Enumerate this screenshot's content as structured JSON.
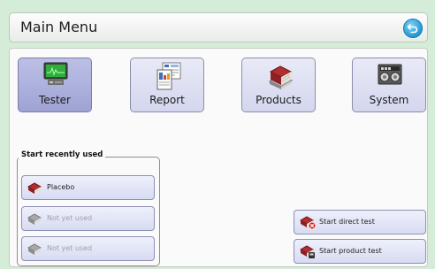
{
  "header": {
    "title": "Main Menu"
  },
  "tiles": [
    {
      "label": "Tester",
      "icon": "tester-monitor-icon",
      "selected": true
    },
    {
      "label": "Report",
      "icon": "report-document-icon",
      "selected": false
    },
    {
      "label": "Products",
      "icon": "products-books-icon",
      "selected": false
    },
    {
      "label": "System",
      "icon": "system-panel-icon",
      "selected": false
    }
  ],
  "recent": {
    "title": "Start recently used",
    "items": [
      {
        "label": "Placebo",
        "enabled": true
      },
      {
        "label": "Not yet used",
        "enabled": false
      },
      {
        "label": "Not yet used",
        "enabled": false
      }
    ]
  },
  "actions": {
    "direct_test": "Start direct test",
    "product_test": "Start product test"
  },
  "colors": {
    "background": "#d5edd8",
    "tile": "#d4d6ee",
    "tile_selected": "#9fa3d4",
    "back_button": "#1e94cf"
  }
}
